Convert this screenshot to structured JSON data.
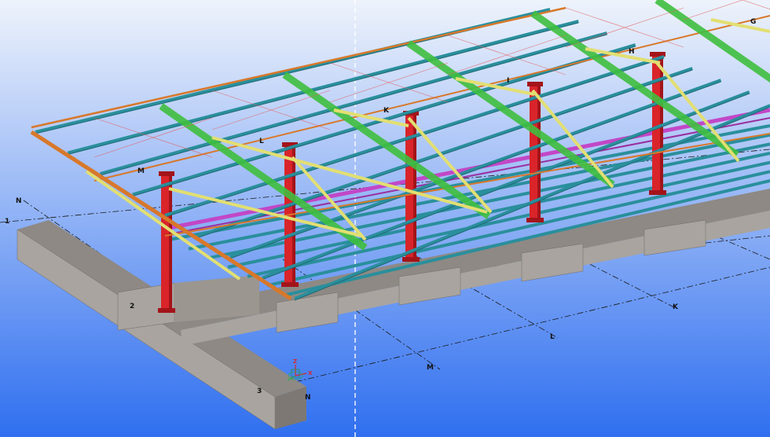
{
  "view": {
    "background_top": "#eef3fb",
    "background_bottom": "#2f6ff0"
  },
  "colors": {
    "column": "#d9242a",
    "column_dark": "#a3141a",
    "purlin": "#2a8f9c",
    "purlin_dark": "#1e6a75",
    "edge_beam": "#d8782a",
    "bracing_green": "#3fbf3f",
    "strut_yellow": "#e2df72",
    "magenta_beam": "#c247c7",
    "concrete": "#a9a49f",
    "concrete_dark": "#7d7873",
    "grid_line": "#1a1a1a"
  },
  "grid_labels": {
    "top_row": [
      "G",
      "H",
      "I",
      "K",
      "L",
      "M"
    ],
    "ground_row": [
      "K",
      "L",
      "M"
    ],
    "left": [
      "N",
      "1",
      "2",
      "3",
      "N"
    ]
  },
  "axis_icon": {
    "x": "X",
    "z": "Z",
    "icon": "coordinate-axes-icon"
  }
}
